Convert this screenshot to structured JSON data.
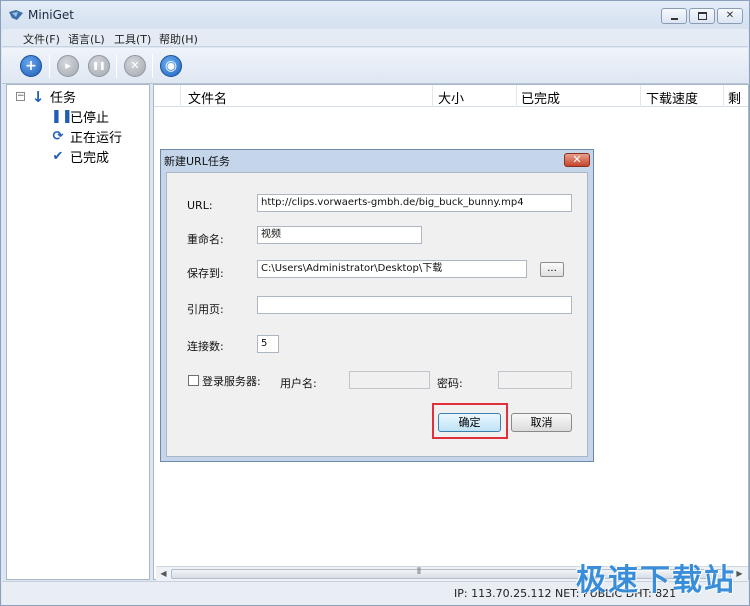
{
  "window": {
    "title": "MiniGet"
  },
  "menu": [
    "文件(F)",
    "语言(L)",
    "工具(T)",
    "帮助(H)"
  ],
  "toolbar": {
    "add_glyph": "+",
    "play_glyph": "▸",
    "pause_glyph": "❚❚",
    "stop_glyph": "✕",
    "settings_glyph": "◉"
  },
  "tree": {
    "root": "任务",
    "items": [
      "已停止",
      "正在运行",
      "已完成"
    ]
  },
  "list": {
    "columns": [
      "文件名",
      "大小",
      "已完成",
      "下载速度",
      "剩"
    ]
  },
  "scrollbar": {
    "grip": "⦀"
  },
  "status": {
    "text": "IP: 113.70.25.112 NET: PUBLIC  DHT: 821"
  },
  "watermark": "极速下载站",
  "dialog": {
    "title": "新建URL任务",
    "url_label": "URL:",
    "url_value": "http://clips.vorwaerts-gmbh.de/big_buck_bunny.mp4",
    "rename_label": "重命名:",
    "rename_value": "视频",
    "save_label": "保存到:",
    "save_value": "C:\\Users\\Administrator\\Desktop\\下载",
    "browse_label": "...",
    "referer_label": "引用页:",
    "referer_value": "",
    "connections_label": "连接数:",
    "connections_value": "5",
    "login_label": "登录服务器:",
    "login_checked": false,
    "username_label": "用户名:",
    "password_label": "密码:",
    "ok_label": "确定",
    "cancel_label": "取消",
    "highlight_color": "#e0303a"
  }
}
